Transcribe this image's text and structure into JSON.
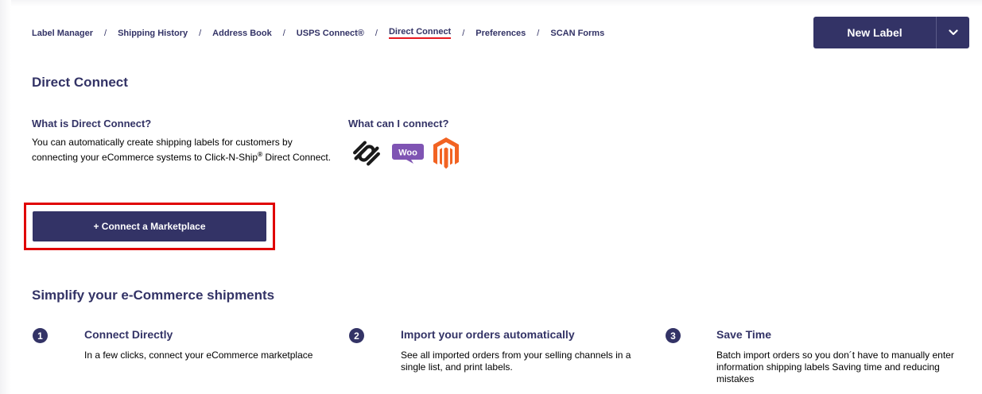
{
  "breadcrumb": {
    "items": [
      {
        "label": "Label Manager"
      },
      {
        "label": "Shipping History"
      },
      {
        "label": "Address Book"
      },
      {
        "label": "USPS Connect®"
      },
      {
        "label": "Direct Connect"
      },
      {
        "label": "Preferences"
      },
      {
        "label": "SCAN Forms"
      }
    ],
    "separator": "/",
    "active_index": 4
  },
  "new_label_button": {
    "label": "New Label",
    "dropdown_icon": "chevron-down-icon"
  },
  "page": {
    "title": "Direct Connect",
    "what_is": {
      "heading": "What is Direct Connect?",
      "text_before": "You can automatically create shipping labels for customers by connecting your eCommerce systems to Click-N-Ship",
      "sup": "®",
      "text_after": " Direct Connect."
    },
    "what_can": {
      "heading": "What can I connect?",
      "logos": [
        "squarespace-logo",
        "woocommerce-logo",
        "magento-logo"
      ],
      "woo_text": "Woo"
    },
    "connect_button": {
      "label": "+ Connect a Marketplace"
    }
  },
  "simplify": {
    "heading": "Simplify your e-Commerce shipments",
    "steps": [
      {
        "number": "1",
        "title": "Connect Directly",
        "text": "In a few clicks, connect your eCommerce marketplace"
      },
      {
        "number": "2",
        "title": "Import your orders automatically",
        "text": "See all imported orders from your selling channels in a single list, and print labels."
      },
      {
        "number": "3",
        "title": "Save Time",
        "text": "Batch import orders so you don´t have to manually enter information shipping labels Saving time and reducing mistakes"
      }
    ]
  },
  "colors": {
    "navy": "#333366",
    "accent_red": "#e71921",
    "highlight_red": "#e00000",
    "woo_purple": "#7f54b3",
    "magento_orange": "#f26322"
  }
}
